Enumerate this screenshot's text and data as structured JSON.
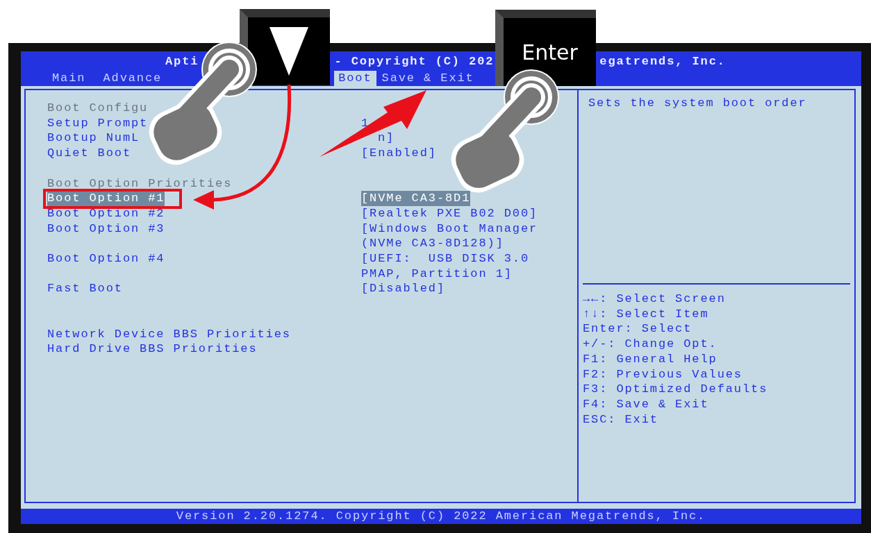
{
  "title_fragments": [
    "Apti",
    "- Copyright (C) 202",
    "egatrends, Inc."
  ],
  "tabs": [
    {
      "label": "Main",
      "selected": false
    },
    {
      "label": "Advance",
      "selected": false
    },
    {
      "label": "Boot",
      "selected": true
    },
    {
      "label": "Save & Exit",
      "selected": false
    }
  ],
  "settings": [
    {
      "kind": "header",
      "label": "Boot Configu"
    },
    {
      "kind": "option",
      "label": "Setup Prompt",
      "value": [
        "1"
      ],
      "selected": false
    },
    {
      "kind": "option",
      "label": "Bootup NumL",
      "value": [
        "n]"
      ],
      "selected": false
    },
    {
      "kind": "option",
      "label": "Quiet Boot",
      "value": [
        "[Enabled]"
      ],
      "selected": false
    },
    {
      "kind": "gap"
    },
    {
      "kind": "header",
      "label": "Boot Option Priorities"
    },
    {
      "kind": "option",
      "label": "Boot Option #1",
      "value": [
        "[NVMe CA3-8D1"
      ],
      "selected": true
    },
    {
      "kind": "option",
      "label": "Boot Option #2",
      "value": [
        "[Realtek PXE B02 D00]"
      ],
      "selected": false
    },
    {
      "kind": "option",
      "label": "Boot Option #3",
      "value": [
        "[Windows Boot Manager",
        "(NVMe CA3-8D128)]"
      ],
      "selected": false
    },
    {
      "kind": "option",
      "label": "Boot Option #4",
      "value": [
        "[UEFI:  USB DISK 3.0",
        "PMAP, Partition 1]"
      ],
      "selected": false
    },
    {
      "kind": "option",
      "label": "Fast Boot",
      "value": [
        "[Disabled]"
      ],
      "selected": false
    },
    {
      "kind": "gap"
    },
    {
      "kind": "gap"
    },
    {
      "kind": "option",
      "label": "Network Device BBS Priorities",
      "selected": false
    },
    {
      "kind": "option",
      "label": "Hard Drive BBS Priorities",
      "selected": false
    }
  ],
  "help_text": "Sets the system boot order",
  "key_hints": [
    "→←: Select Screen",
    "↑↓: Select Item",
    "Enter: Select",
    "+/-: Change Opt.",
    "F1: General Help",
    "F2: Previous Values",
    "F3: Optimized Defaults",
    "F4: Save & Exit",
    "ESC: Exit"
  ],
  "footer": "Version 2.20.1274. Copyright (C) 2022 American Megatrends, Inc.",
  "overlay_keys": [
    {
      "kind": "arrow"
    },
    {
      "kind": "text",
      "label": "Enter"
    }
  ]
}
